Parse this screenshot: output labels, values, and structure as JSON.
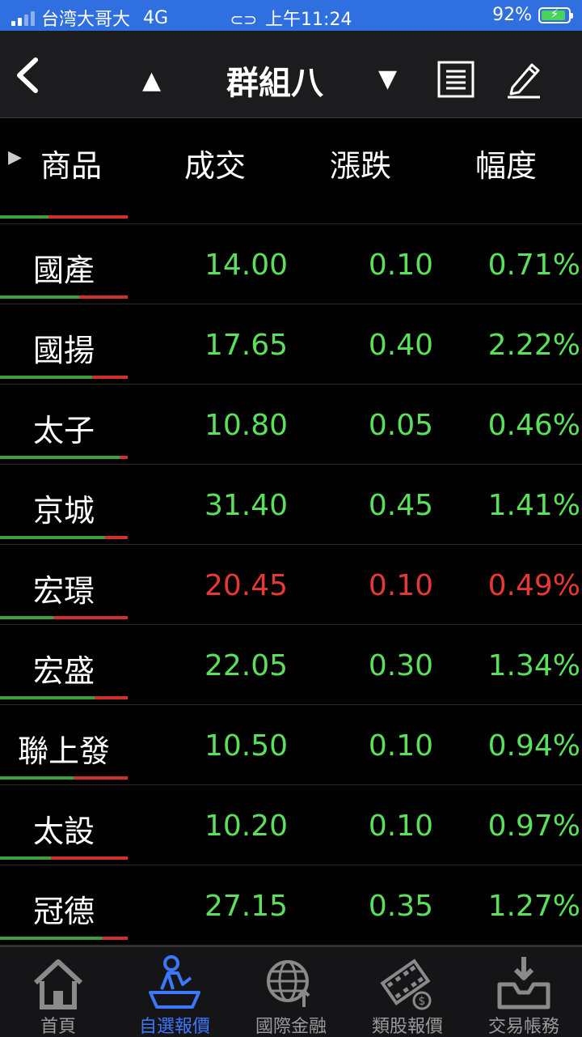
{
  "status": {
    "carrier": "台湾大哥大",
    "network": "4G",
    "time": "上午11:24",
    "battery": "92%",
    "battery_level": 0.92,
    "battery_color": "#48d35a"
  },
  "nav": {
    "title": "群組八",
    "icons": [
      "back-chevron-icon",
      "up-triangle-icon",
      "down-triangle-icon",
      "list-icon",
      "edit-pencil-icon"
    ]
  },
  "header": {
    "name": "商品",
    "price": "成交",
    "change": "漲跌",
    "pct": "幅度",
    "bar_green_fraction": 0.38
  },
  "colors": {
    "up": "#5be05b",
    "down": "#e53935",
    "accent": "#3b78ff",
    "bar_green": "#3aa13a",
    "bar_red": "#d23030"
  },
  "rows": [
    {
      "name": "國產",
      "price": "14.00",
      "change": "0.10",
      "pct": "0.71%",
      "dir": "up",
      "bar_green_fraction": 0.62
    },
    {
      "name": "國揚",
      "price": "17.65",
      "change": "0.40",
      "pct": "2.22%",
      "dir": "up",
      "bar_green_fraction": 0.72
    },
    {
      "name": "太子",
      "price": "10.80",
      "change": "0.05",
      "pct": "0.46%",
      "dir": "up",
      "bar_green_fraction": 0.94
    },
    {
      "name": "京城",
      "price": "31.40",
      "change": "0.45",
      "pct": "1.41%",
      "dir": "up",
      "bar_green_fraction": 0.82
    },
    {
      "name": "宏璟",
      "price": "20.45",
      "change": "0.10",
      "pct": "0.49%",
      "dir": "down",
      "bar_green_fraction": 0.42
    },
    {
      "name": "宏盛",
      "price": "22.05",
      "change": "0.30",
      "pct": "1.34%",
      "dir": "up",
      "bar_green_fraction": 0.74
    },
    {
      "name": "聯上發",
      "price": "10.50",
      "change": "0.10",
      "pct": "0.94%",
      "dir": "up",
      "bar_green_fraction": 0.58
    },
    {
      "name": "太設",
      "price": "10.20",
      "change": "0.10",
      "pct": "0.97%",
      "dir": "up",
      "bar_green_fraction": 0.4
    },
    {
      "name": "冠德",
      "price": "27.15",
      "change": "0.35",
      "pct": "1.27%",
      "dir": "up",
      "bar_green_fraction": 0.8
    }
  ],
  "tabs": [
    {
      "label": "首頁",
      "icon": "home-icon",
      "active": false
    },
    {
      "label": "自選報價",
      "icon": "person-desk-icon",
      "active": true
    },
    {
      "label": "國際金融",
      "icon": "globe-icon",
      "active": false
    },
    {
      "label": "類股報價",
      "icon": "film-coin-icon",
      "active": false
    },
    {
      "label": "交易帳務",
      "icon": "inbox-download-icon",
      "active": false
    }
  ]
}
